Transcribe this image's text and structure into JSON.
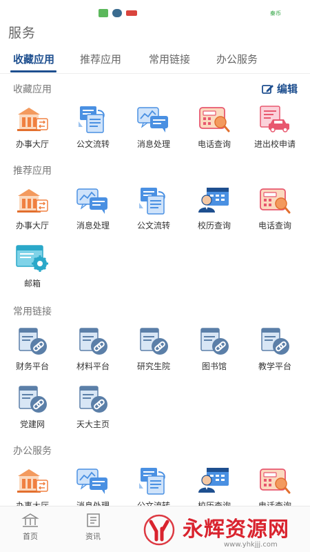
{
  "status_bar": {
    "right_text": "秦币"
  },
  "page_title": "服务",
  "tabs": [
    {
      "label": "收藏应用",
      "active": true
    },
    {
      "label": "推荐应用",
      "active": false
    },
    {
      "label": "常用链接",
      "active": false
    },
    {
      "label": "办公服务",
      "active": false
    }
  ],
  "sections": {
    "favorites": {
      "title": "收藏应用",
      "edit_label": "编辑",
      "items": [
        {
          "label": "办事大厅",
          "icon": "building-icon"
        },
        {
          "label": "公文流转",
          "icon": "document-flow-icon"
        },
        {
          "label": "消息处理",
          "icon": "message-icon"
        },
        {
          "label": "电话查询",
          "icon": "phone-search-icon"
        },
        {
          "label": "进出校申请",
          "icon": "car-pass-icon"
        }
      ]
    },
    "recommended": {
      "title": "推荐应用",
      "items": [
        {
          "label": "办事大厅",
          "icon": "building-icon"
        },
        {
          "label": "消息处理",
          "icon": "message-icon"
        },
        {
          "label": "公文流转",
          "icon": "document-flow-icon"
        },
        {
          "label": "校历查询",
          "icon": "calendar-person-icon"
        },
        {
          "label": "电话查询",
          "icon": "phone-search-icon"
        },
        {
          "label": "邮箱",
          "icon": "mail-settings-icon"
        }
      ]
    },
    "links": {
      "title": "常用链接",
      "items": [
        {
          "label": "财务平台",
          "icon": "link-doc-icon"
        },
        {
          "label": "材料平台",
          "icon": "link-doc-icon"
        },
        {
          "label": "研究生院",
          "icon": "link-doc-icon"
        },
        {
          "label": "图书馆",
          "icon": "link-doc-icon"
        },
        {
          "label": "教学平台",
          "icon": "link-doc-icon"
        },
        {
          "label": "党建网",
          "icon": "link-doc-icon"
        },
        {
          "label": "天大主页",
          "icon": "link-doc-icon"
        }
      ]
    },
    "office": {
      "title": "办公服务",
      "items": [
        {
          "label": "办事大厅",
          "icon": "building-icon"
        },
        {
          "label": "消息处理",
          "icon": "message-icon"
        },
        {
          "label": "公文流转",
          "icon": "document-flow-icon"
        },
        {
          "label": "校历查询",
          "icon": "calendar-person-icon"
        },
        {
          "label": "电话查询",
          "icon": "phone-search-icon"
        }
      ]
    }
  },
  "bottom_nav": [
    {
      "label": "首页",
      "icon": "home-bank-icon"
    },
    {
      "label": "资讯",
      "icon": "news-icon"
    }
  ],
  "watermark": {
    "text": "永辉资源网",
    "url": "www.yhkjjj.com"
  },
  "colors": {
    "accent": "#1e4f8f",
    "orange": "#f0874a",
    "blue": "#4a90e2",
    "pink": "#e8576e"
  }
}
